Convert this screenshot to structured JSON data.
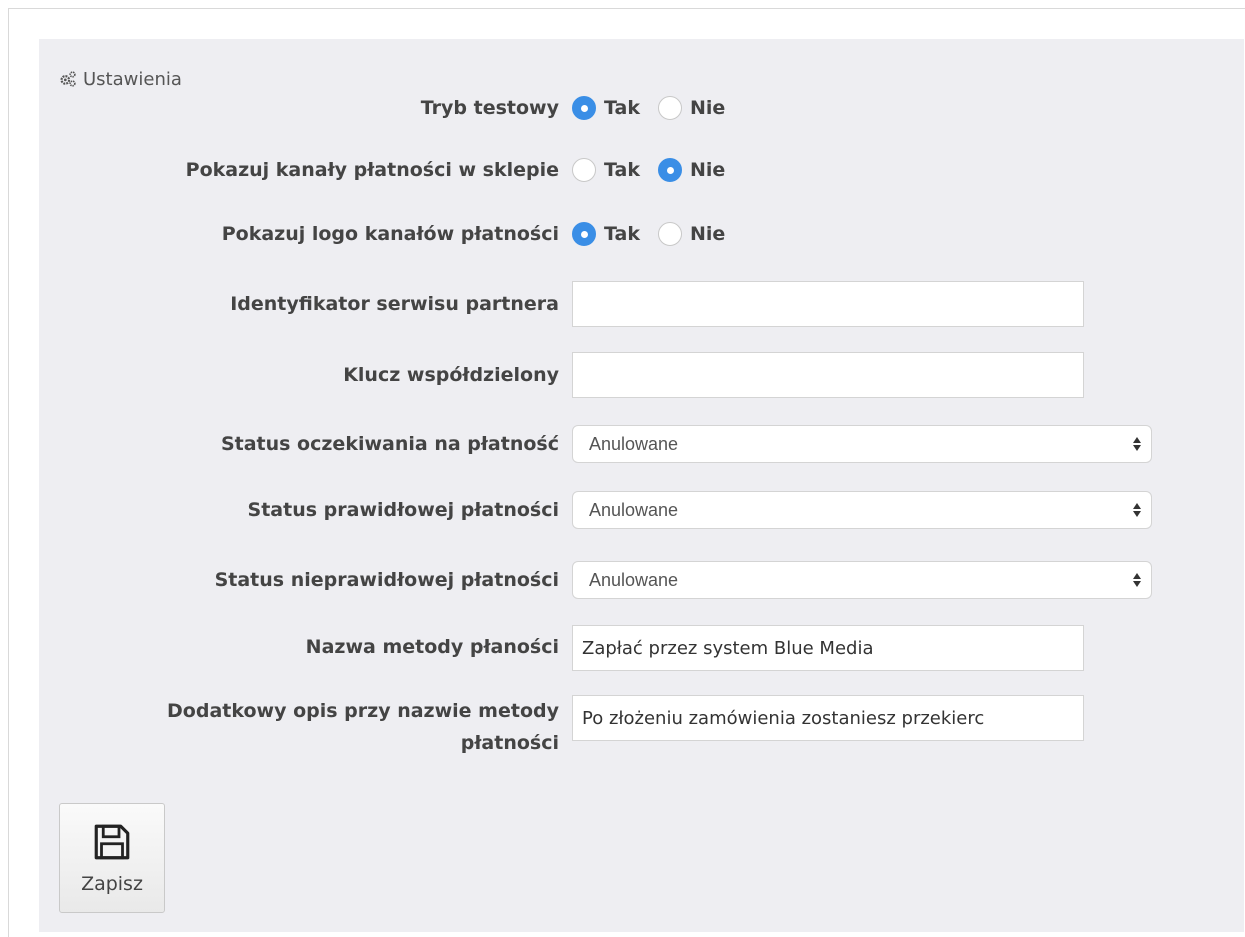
{
  "panel": {
    "heading": "Ustawienia",
    "heading_icon": "cogs-icon"
  },
  "fields": {
    "test_mode": {
      "label": "Tryb testowy",
      "yes": "Tak",
      "no": "Nie",
      "selected": "Tak"
    },
    "show_channels": {
      "label": "Pokazuj kanały płatności w sklepie",
      "yes": "Tak",
      "no": "Nie",
      "selected": "Nie"
    },
    "show_logo": {
      "label": "Pokazuj logo kanałów płatności",
      "yes": "Tak",
      "no": "Nie",
      "selected": "Tak"
    },
    "partner_id": {
      "label": "Identyfikator serwisu partnera",
      "value": ""
    },
    "shared_key": {
      "label": "Klucz współdzielony",
      "value": ""
    },
    "status_pending": {
      "label": "Status oczekiwania na płatność",
      "value": "Anulowane"
    },
    "status_success": {
      "label": "Status prawidłowej płatności",
      "value": "Anulowane"
    },
    "status_failure": {
      "label": "Status nieprawidłowej płatności",
      "value": "Anulowane"
    },
    "method_name": {
      "label": "Nazwa metody płaności",
      "value": "Zapłać przez system Blue Media"
    },
    "method_desc": {
      "label_line1": "Dodatkowy opis przy nazwie metody",
      "label_line2": "płatności",
      "value": "Po złożeniu zamówienia zostaniesz przekierc"
    }
  },
  "save_button": {
    "label": "Zapisz",
    "icon": "floppy-disk-icon"
  },
  "colors": {
    "accent": "#3a8ee6",
    "panel_bg": "#eeeef2"
  }
}
